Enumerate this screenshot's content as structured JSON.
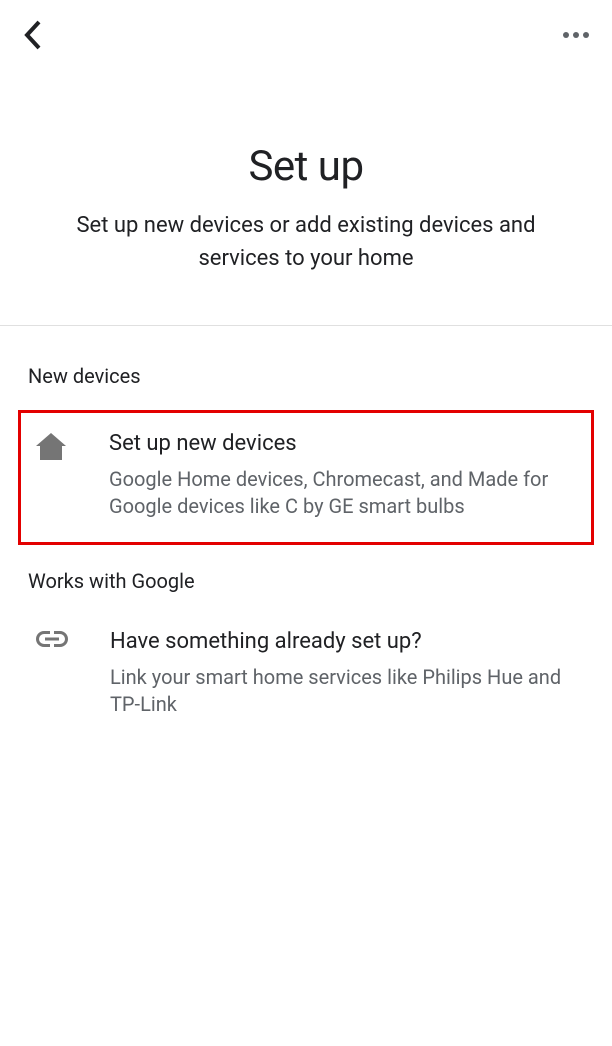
{
  "title": "Set up",
  "subtitle": "Set up new devices or add existing devices and services to your home",
  "sections": [
    {
      "header": "New devices",
      "option": {
        "title": "Set up new devices",
        "desc": "Google Home devices, Chromecast, and Made for Google devices like C by GE smart bulbs"
      }
    },
    {
      "header": "Works with Google",
      "option": {
        "title": "Have something already set up?",
        "desc": "Link your smart home services like Philips Hue and TP-Link"
      }
    }
  ]
}
